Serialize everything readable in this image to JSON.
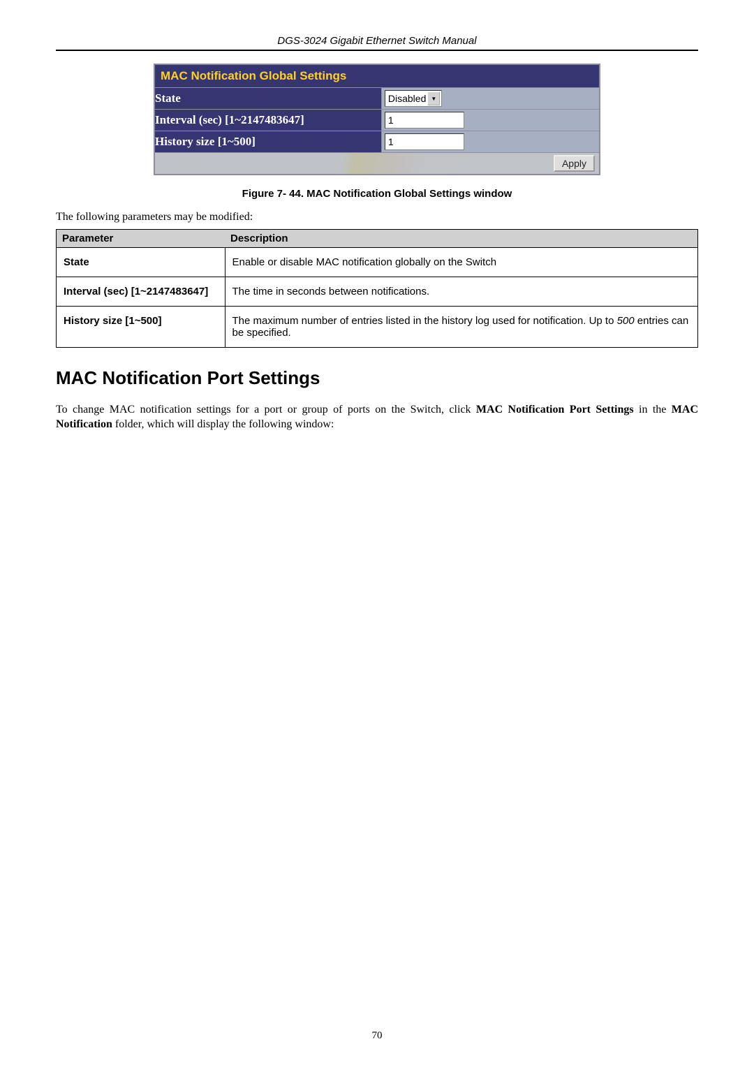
{
  "header": {
    "title": "DGS-3024 Gigabit Ethernet Switch Manual"
  },
  "figure_table": {
    "title": "MAC Notification Global Settings",
    "rows": {
      "state": {
        "label": "State",
        "value": "Disabled"
      },
      "interval": {
        "label": "Interval (sec) [1~2147483647]",
        "value": "1"
      },
      "history": {
        "label": "History size [1~500]",
        "value": "1"
      }
    },
    "apply_label": "Apply"
  },
  "figure_caption": "Figure 7- 44. MAC Notification Global Settings window",
  "intro_line": "The following parameters may be modified:",
  "param_table": {
    "header": {
      "col1": "Parameter",
      "col2": "Description"
    },
    "rows": [
      {
        "name": "State",
        "desc": "Enable or disable MAC notification globally on the Switch"
      },
      {
        "name": "Interval (sec) [1~2147483647]",
        "desc": "The time in seconds between notifications."
      },
      {
        "name": "History size [1~500]",
        "desc_a": "The maximum number of entries listed in the history log used for notification. Up to ",
        "desc_i": "500",
        "desc_b": " entries can be specified."
      }
    ]
  },
  "section_heading": "MAC Notification Port Settings",
  "body_para_a": "To change MAC notification settings for a port or group of ports on the Switch, click ",
  "body_para_b": "MAC Notification Port Settings",
  "body_para_c": " in the ",
  "body_para_d": "MAC Notification",
  "body_para_e": " folder, which will display the following window:",
  "page_number": "70"
}
